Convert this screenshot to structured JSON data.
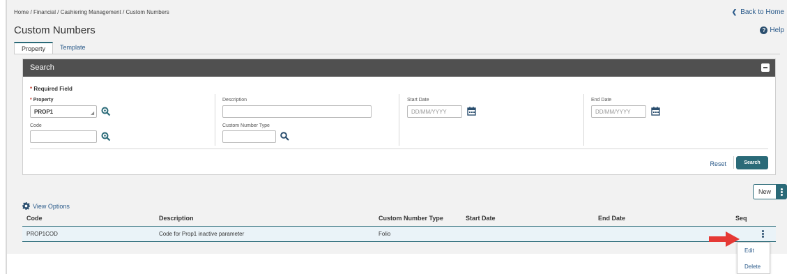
{
  "breadcrumb": "Home / Financial / Cashiering Management / Custom Numbers",
  "back_home": "Back to Home",
  "page_title": "Custom Numbers",
  "help": "Help",
  "tabs": [
    {
      "label": "Property"
    },
    {
      "label": "Template"
    }
  ],
  "search_panel": {
    "title": "Search",
    "required_legend": "Required Field",
    "property": {
      "label": "Property",
      "value": "PROP1"
    },
    "code": {
      "label": "Code",
      "value": ""
    },
    "description": {
      "label": "Description",
      "value": ""
    },
    "custom_number_type": {
      "label": "Custom Number Type",
      "value": ""
    },
    "start_date": {
      "label": "Start Date",
      "placeholder": "DD/MM/YYYY"
    },
    "end_date": {
      "label": "End Date",
      "placeholder": "DD/MM/YYYY"
    },
    "reset_label": "Reset",
    "search_label": "Search"
  },
  "new_label": "New",
  "view_options": "View Options",
  "table": {
    "columns": [
      "Code",
      "Description",
      "Custom Number Type",
      "Start Date",
      "End Date",
      "Seq"
    ],
    "rows": [
      [
        "PROP1COD",
        "Code for Prop1 inactive parameter",
        "Folio",
        "",
        "",
        ""
      ]
    ]
  },
  "row_menu": {
    "items": [
      "Edit",
      "Delete"
    ]
  },
  "colors": {
    "accent": "#2a6a78",
    "link": "#2a5a8a",
    "header_bar": "#505050",
    "row_highlight": "#eaf3f8",
    "arrow": "#e53935"
  },
  "icons": [
    "chevron-left-icon",
    "help-icon",
    "collapse-icon",
    "search-icon",
    "calendar-icon",
    "gear-icon",
    "kebab-icon",
    "arrow-icon"
  ]
}
